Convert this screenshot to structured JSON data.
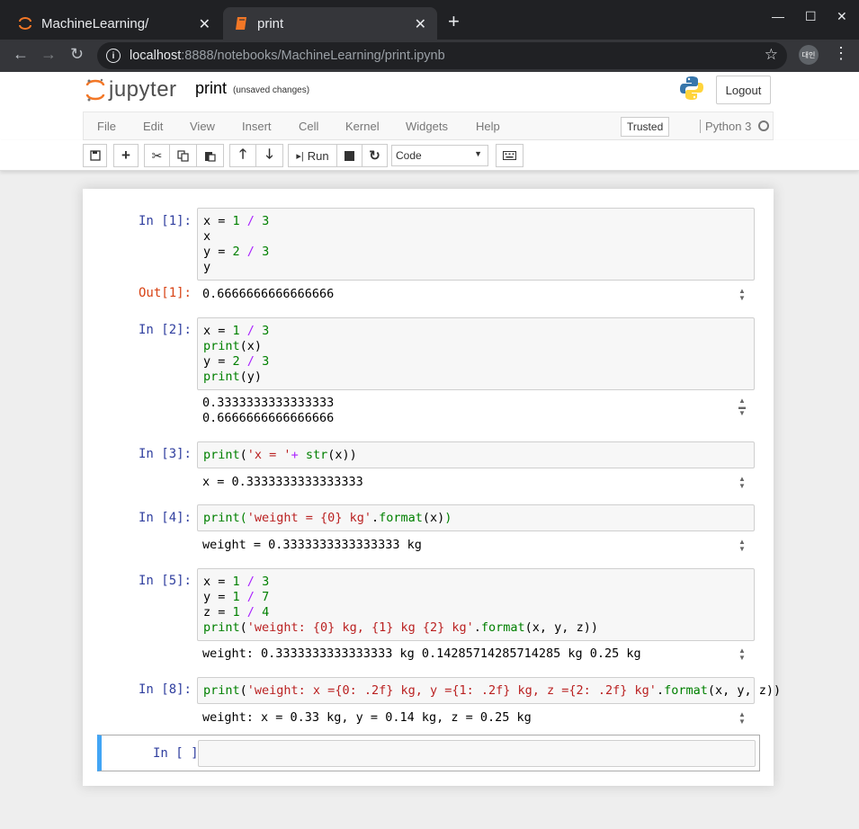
{
  "browser": {
    "tabs": [
      {
        "title": "MachineLearning/",
        "icon": "jupyter-favicon-icon"
      },
      {
        "title": "print",
        "icon": "notebook-favicon-icon",
        "active": true
      }
    ],
    "url_host": "localhost",
    "url_path": ":8888/notebooks/MachineLearning/print.ipynb",
    "profile_label": "대인"
  },
  "jupyter": {
    "logo_text": "jupyter",
    "notebook_name": "print",
    "save_status": "(unsaved changes)",
    "logout_label": "Logout",
    "menu": [
      "File",
      "Edit",
      "View",
      "Insert",
      "Cell",
      "Kernel",
      "Widgets",
      "Help"
    ],
    "trusted_label": "Trusted",
    "kernel_name": "Python 3",
    "run_label": "Run",
    "cell_type": "Code"
  },
  "cells": {
    "c1": {
      "prompt": "In [1]:",
      "out_prompt": "Out[1]:",
      "output": "0.6666666666666666"
    },
    "c2": {
      "prompt": "In [2]:",
      "output1": "0.3333333333333333",
      "output2": "0.6666666666666666"
    },
    "c3": {
      "prompt": "In [3]:",
      "output": "x = 0.3333333333333333"
    },
    "c4": {
      "prompt": "In [4]:",
      "output": "weight = 0.3333333333333333 kg"
    },
    "c5": {
      "prompt": "In [5]:",
      "output": "weight: 0.3333333333333333 kg 0.14285714285714285 kg 0.25 kg"
    },
    "c8": {
      "prompt": "In [8]:",
      "output": "weight: x = 0.33 kg, y = 0.14 kg, z = 0.25 kg"
    },
    "empty": {
      "prompt": "In [ ]:"
    }
  },
  "colors": {
    "accent_cell": "#42a5f5",
    "in_prompt": "#303f9f",
    "out_prompt": "#d84315"
  }
}
